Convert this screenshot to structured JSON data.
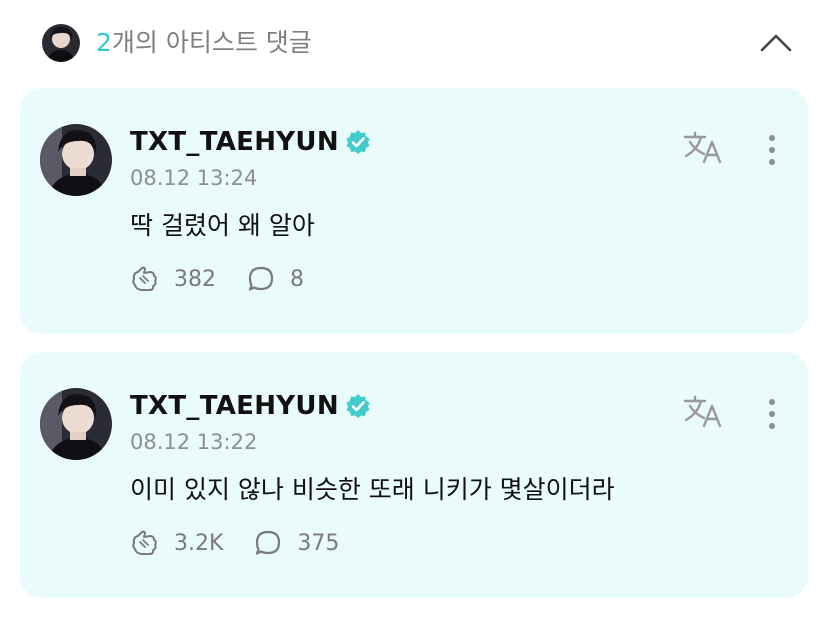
{
  "header": {
    "count": "2",
    "title_suffix": "개의 아티스트 댓글"
  },
  "comments": [
    {
      "username": "TXT_TAEHYUN",
      "timestamp": "08.12 13:24",
      "text": "딱 걸렸어 왜 알아",
      "likes": "382",
      "replies": "8"
    },
    {
      "username": "TXT_TAEHYUN",
      "timestamp": "08.12 13:22",
      "text": "이미 있지 않나 비슷한 또래 니키가 몇살이더라",
      "likes": "3.2K",
      "replies": "375"
    }
  ],
  "icons": {
    "verified": "verified-badge-icon",
    "translate": "translate-icon",
    "more": "more-vertical-icon",
    "like": "like-hands-icon",
    "reply": "comment-bubble-icon",
    "collapse": "chevron-up-icon"
  },
  "colors": {
    "accent": "#35c7c7",
    "card_background": "#e9fbfb",
    "muted_text": "#8e8e8e"
  }
}
